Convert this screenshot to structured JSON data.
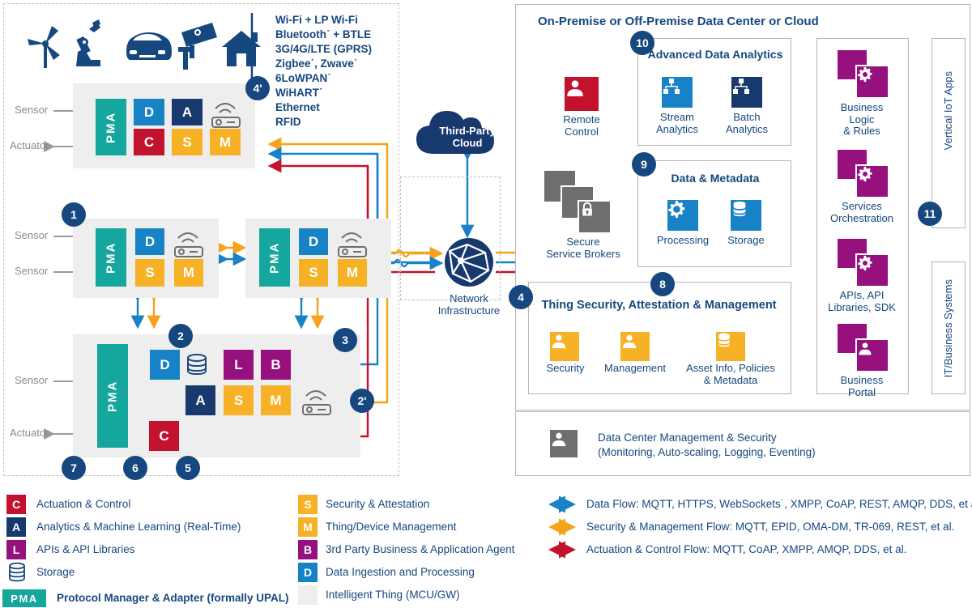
{
  "title_datacenter": "On-Premise or Off-Premise Data Center or Cloud",
  "protocols": [
    "Wi-Fi + LP Wi-Fi",
    "Bluetooth˙ + BTLE",
    "3G/4G/LTE (GPRS)",
    "Zigbee˙, Zwave˙",
    "6LoWPAN˙",
    "WiHART˙",
    "Ethernet",
    "RFID"
  ],
  "edge": {
    "sensor": "Sensor",
    "actuator": "Actuator",
    "thing1": {
      "row1": [
        "PMA",
        "D",
        "A"
      ],
      "row2": [
        "C",
        "S",
        "M"
      ]
    },
    "thing2": {
      "row1": [
        "PMA",
        "D"
      ],
      "row2": [
        "S",
        "M"
      ]
    },
    "thing3": {
      "row1": [
        "PMA",
        "D"
      ],
      "row2": [
        "S",
        "M"
      ]
    },
    "gateway": {
      "row1": [
        "PMA",
        "D",
        "L",
        "B"
      ],
      "row2": [
        "A",
        "S",
        "M"
      ],
      "row3": [
        "C"
      ]
    }
  },
  "cloud": {
    "third_party": "Third-Party\nCloud",
    "third_party_l1": "Third-Party",
    "third_party_l2": "Cloud",
    "network_l1": "Network",
    "network_l2": "Infrastructure"
  },
  "dc": {
    "remote_control_l1": "Remote",
    "remote_control_l2": "Control",
    "brokers_l1": "Secure",
    "brokers_l2": "Service Brokers",
    "analytics_title": "Advanced Data Analytics",
    "analytics_items": [
      "Stream\nAnalytics",
      "Batch\nAnalytics"
    ],
    "stream_l1": "Stream",
    "stream_l2": "Analytics",
    "batch_l1": "Batch",
    "batch_l2": "Analytics",
    "metadata_title": "Data & Metadata",
    "processing": "Processing",
    "storage": "Storage",
    "thingsec_title": "Thing Security, Attestation & Management",
    "security": "Security",
    "management": "Management",
    "asset_l1": "Asset Info, Policies",
    "asset_l2": "& Metadata",
    "dcms_l1": "Data Center Management & Security",
    "dcms_l2": "(Monitoring, Auto-scaling, Logging, Eventing)",
    "business": [
      {
        "l1": "Business",
        "l2": "Logic",
        "l3": "& Rules"
      },
      {
        "l1": "Services",
        "l2": "Orchestration",
        "l3": ""
      },
      {
        "l1": "APIs, API",
        "l2": "Libraries, SDK",
        "l3": ""
      },
      {
        "l1": "Business",
        "l2": "Portal",
        "l3": ""
      }
    ],
    "vertical_apps": "Vertical IoT Apps",
    "it_business": "IT/Business Systems"
  },
  "badges": [
    "1",
    "2",
    "2'",
    "3",
    "4",
    "4'",
    "5",
    "6",
    "7",
    "8",
    "9",
    "10",
    "11"
  ],
  "legend_left": [
    {
      "key": "C",
      "label": "Actuation & Control",
      "color": "#c3122d"
    },
    {
      "key": "A",
      "label": "Analytics & Machine Learning (Real-Time)",
      "color": "#17396d"
    },
    {
      "key": "L",
      "label": "APIs & API Libraries",
      "color": "#96117e"
    },
    {
      "key": "",
      "label": "Storage",
      "color": ""
    },
    {
      "key": "PMA",
      "label": "Protocol Manager & Adapter (formally UPAL)",
      "color": "#15a79d"
    }
  ],
  "legend_mid": [
    {
      "key": "S",
      "label": "Security & Attestation",
      "color": "#f6b127"
    },
    {
      "key": "M",
      "label": "Thing/Device Management",
      "color": "#f6b127"
    },
    {
      "key": "B",
      "label": "3rd Party Business & Application Agent",
      "color": "#96117e"
    },
    {
      "key": "D",
      "label": "Data Ingestion and Processing",
      "color": "#1782c5"
    },
    {
      "key": "",
      "label": "Intelligent Thing (MCU/GW)",
      "color": "#eeeeee"
    }
  ],
  "legend_right": [
    {
      "color": "#1782c5",
      "label": "Data Flow: MQTT, HTTPS, WebSockets˙, XMPP, CoAP, REST, AMQP, DDS, et al."
    },
    {
      "color": "#f6a21d",
      "label": "Security & Management Flow: MQTT, EPID, OMA-DM, TR-069, REST, et al."
    },
    {
      "color": "#c3122d",
      "label": "Actuation & Control Flow: MQTT, CoAP, XMPP, AMQP, DDS, et al."
    }
  ],
  "icons_top": [
    "wind-turbine",
    "robot-arm",
    "car",
    "security-camera",
    "house"
  ],
  "colors": {
    "navy": "#16477e",
    "blue": "#1782c5",
    "amber": "#f6b127",
    "orange": "#f6a21d",
    "red": "#c3122d",
    "purple": "#96117e",
    "teal": "#15a79d",
    "darkblue": "#17396d",
    "grey": "#6e6e6e"
  }
}
